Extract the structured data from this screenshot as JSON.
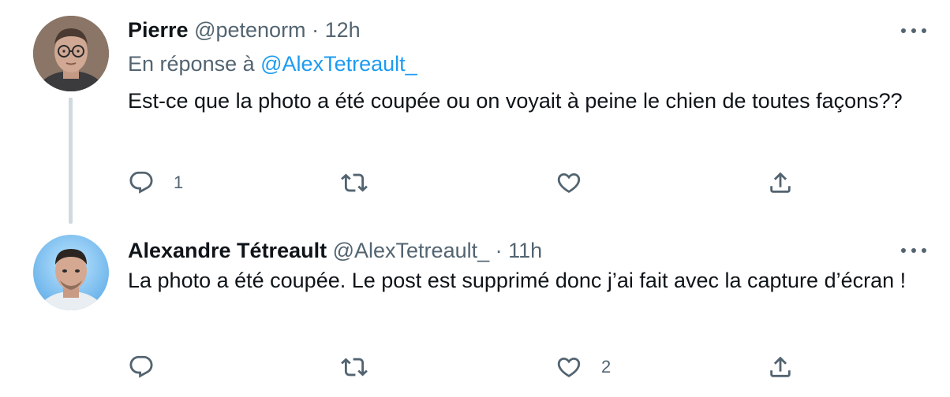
{
  "tweets": [
    {
      "display_name": "Pierre",
      "handle": "@petenorm",
      "separator": "·",
      "time": "12h",
      "reply_prefix": "En réponse à",
      "reply_mention": "@AlexTetreault_",
      "text": "Est-ce que la photo a été coupée ou on voyait à peine le chien de toutes façons??",
      "reply_count": "1",
      "retweet_count": "",
      "like_count": ""
    },
    {
      "display_name": "Alexandre Tétreault",
      "handle": "@AlexTetreault_",
      "separator": "·",
      "time": "11h",
      "text": "La photo a été coupée. Le post est supprimé donc j’ai fait avec la capture d’écran !",
      "reply_count": "",
      "retweet_count": "",
      "like_count": "2"
    }
  ],
  "icons": {
    "reply": "reply-icon",
    "retweet": "retweet-icon",
    "like": "like-icon",
    "share": "share-icon",
    "more": "more-icon"
  },
  "colors": {
    "text_primary": "#0f1419",
    "text_secondary": "#536471",
    "link": "#1d9bf0",
    "thread_line": "#cfd9de"
  }
}
